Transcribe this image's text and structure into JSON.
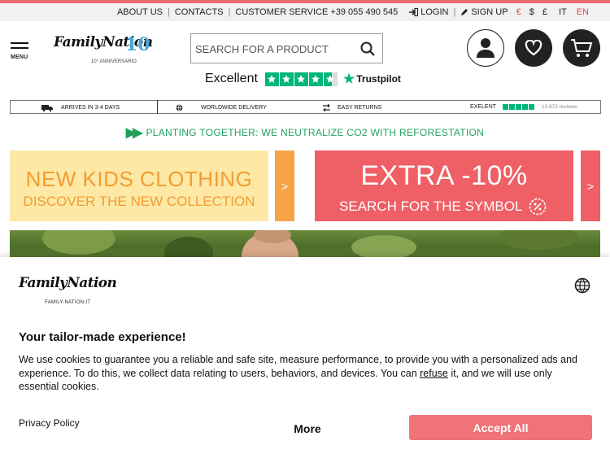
{
  "topbar": {
    "about": "ABOUT US",
    "contacts": "CONTACTS",
    "customer_service": "CUSTOMER SERVICE +39 055 490 545",
    "login": "LOGIN",
    "signup": "SIGN UP",
    "currencies": [
      "€",
      "$",
      "£"
    ],
    "languages": [
      "IT",
      "EN"
    ],
    "accent_color": "#e8434f"
  },
  "header": {
    "menu_label": "MENU",
    "logo_text": "FamilyNation",
    "logo_badge": "10",
    "logo_subtitle": "10° ANNIVERSARIO",
    "search_placeholder": "SEARCH FOR A PRODUCT",
    "trust_label": "Excellent",
    "trust_brand": "Trustpilot",
    "trust_rating_stars": 4.5
  },
  "infobar": {
    "shipping": "ARRIVES IN 3-4 DAYS",
    "delivery": "WORLDWIDE DELIVERY",
    "returns": "EASY RETURNS",
    "rating_label": "EXELENT",
    "reviews": "13.873 reviews"
  },
  "planting": {
    "text": "PLANTING TOGETHER: WE NEUTRALIZE CO2 WITH REFORESTATION",
    "color": "#20a15f"
  },
  "banners": {
    "kids_title": "NEW KIDS CLOTHING",
    "kids_subtitle": "DISCOVER THE NEW COLLECTION",
    "promo_title": "EXTRA -10%",
    "promo_subtitle": "SEARCH FOR THE SYMBOL",
    "arrow": ">"
  },
  "cookie": {
    "logo_text": "FamilyNation",
    "logo_sub": "FAMILY-NATION.IT",
    "title": "Your tailor-made experience!",
    "text_before": "We use cookies to guarantee you a reliable and safe site, measure performance, to provide you with a personalized ads and experience. To do this, we collect data relating to users, behaviors, and devices. You can ",
    "refuse_link": "refuse",
    "text_after": " it, and we will use only essential cookies.",
    "privacy": "Privacy Policy",
    "more": "More",
    "accept": "Accept All",
    "accept_color": "#f07379"
  }
}
